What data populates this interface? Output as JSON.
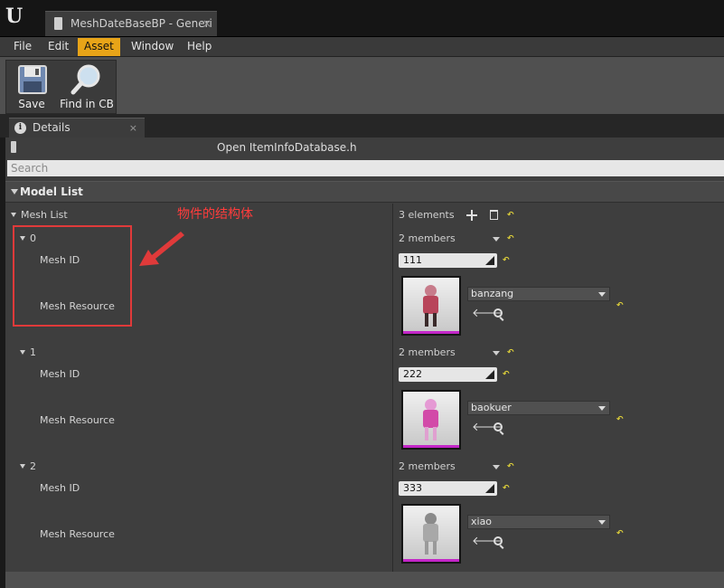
{
  "window": {
    "tab_title": "MeshDateBaseBP - Generi",
    "tab_close": "×"
  },
  "menu": {
    "items": [
      "File",
      "Edit",
      "Asset",
      "Window",
      "Help"
    ],
    "active": "Asset"
  },
  "toolbar": {
    "save_label": "Save",
    "find_label": "Find in CB"
  },
  "details": {
    "tab_label": "Details",
    "tab_close": "×",
    "open_link": "Open ItemInfoDatabase.h",
    "search_placeholder": "Search",
    "category": "Model List",
    "mesh_list_label": "Mesh List",
    "elements_count": "3 elements",
    "items": [
      {
        "index": "0",
        "members": "2 members",
        "mesh_id_label": "Mesh ID",
        "mesh_id_value": "111",
        "resource_label": "Mesh Resource",
        "resource_value": "banzang"
      },
      {
        "index": "1",
        "members": "2 members",
        "mesh_id_label": "Mesh ID",
        "mesh_id_value": "222",
        "resource_label": "Mesh Resource",
        "resource_value": "baokuer"
      },
      {
        "index": "2",
        "members": "2 members",
        "mesh_id_label": "Mesh ID",
        "mesh_id_value": "333",
        "resource_label": "Mesh Resource",
        "resource_value": "xiao"
      }
    ]
  },
  "annotation": {
    "text": "物件的结构体",
    "color": "#e03a3a"
  },
  "colors": {
    "accent": "#e8a418",
    "highlight": "#c326c8"
  }
}
